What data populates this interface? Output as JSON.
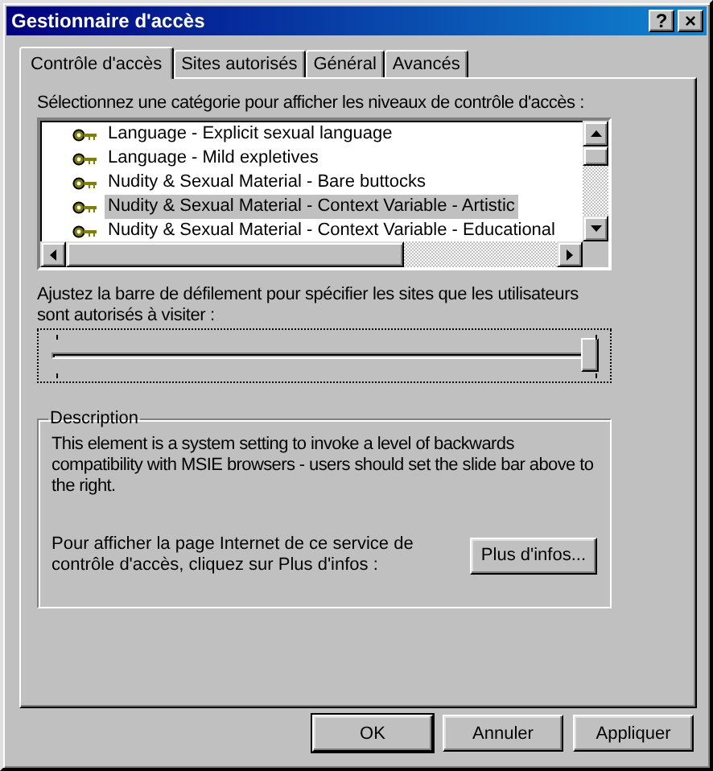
{
  "window": {
    "title": "Gestionnaire d'accès"
  },
  "title_buttons": [
    "?",
    "×"
  ],
  "tabs": [
    {
      "label": "Contrôle d'accès",
      "selected": true
    },
    {
      "label": "Sites autorisés",
      "selected": false
    },
    {
      "label": "Général",
      "selected": false
    },
    {
      "label": "Avancés",
      "selected": false
    }
  ],
  "category_label": "Sélectionnez une catégorie pour afficher les niveaux de contrôle d'accès :",
  "categories": [
    {
      "label": "Language - Explicit sexual language",
      "selected": false
    },
    {
      "label": "Language - Mild expletives",
      "selected": false
    },
    {
      "label": "Nudity & Sexual Material - Bare buttocks",
      "selected": false
    },
    {
      "label": "Nudity & Sexual Material - Context Variable - Artistic",
      "selected": true
    },
    {
      "label": "Nudity & Sexual Material - Context Variable - Educational",
      "selected": false
    }
  ],
  "slider_label": "Ajustez la barre de défilement pour spécifier les sites que les utilisateurs sont autorisés à visiter :",
  "slider": {
    "level": 1
  },
  "description": {
    "title": "Description",
    "text": "This element is a system setting to invoke a level of backwards compatibility with MSIE browsers - users should set the slide bar above to the right.",
    "more_text": "Pour afficher la page Internet de ce service de contrôle d'accès, cliquez sur Plus d'infos :",
    "more_button": "Plus d'infos..."
  },
  "buttons": [
    {
      "label": "OK",
      "default": true
    },
    {
      "label": "Annuler",
      "default": false
    },
    {
      "label": "Appliquer",
      "default": false
    }
  ]
}
